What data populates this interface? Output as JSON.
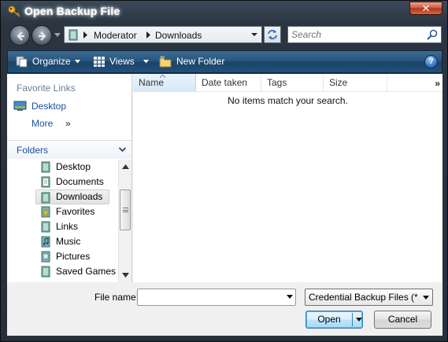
{
  "window": {
    "title": "Open Backup File",
    "title_icon": "key-icon",
    "close_glyph": "✕"
  },
  "address_bar": {
    "segments": [
      "Moderator",
      "Downloads"
    ],
    "folder_icon": "folder-icon"
  },
  "search": {
    "placeholder": "Search",
    "value": ""
  },
  "command_bar": {
    "organize_label": "Organize",
    "views_label": "Views",
    "new_folder_label": "New Folder",
    "help_glyph": "?"
  },
  "favorite_links": {
    "header": "Favorite Links",
    "items": [
      {
        "label": "Desktop",
        "icon": "desktop-icon"
      },
      {
        "label": "More",
        "icon": "chevron-right-icon",
        "suffix": "»"
      }
    ]
  },
  "folders": {
    "header": "Folders",
    "items": [
      {
        "label": "Desktop",
        "icon": "folder-icon",
        "selected": false
      },
      {
        "label": "Documents",
        "icon": "documents-icon",
        "selected": false
      },
      {
        "label": "Downloads",
        "icon": "folder-icon",
        "selected": true
      },
      {
        "label": "Favorites",
        "icon": "star-folder-icon",
        "selected": false
      },
      {
        "label": "Links",
        "icon": "folder-icon",
        "selected": false
      },
      {
        "label": "Music",
        "icon": "music-icon",
        "selected": false
      },
      {
        "label": "Pictures",
        "icon": "pictures-icon",
        "selected": false
      },
      {
        "label": "Saved Games",
        "icon": "folder-icon",
        "selected": false
      }
    ]
  },
  "file_list": {
    "columns": [
      "Name",
      "Date taken",
      "Tags",
      "Size"
    ],
    "more_columns_glyph": "»",
    "empty_message": "No items match your search."
  },
  "footer": {
    "file_name_label": "File name:",
    "file_name_value": "",
    "filter_value": "Credential Backup Files (*.crd",
    "open_label": "Open",
    "cancel_label": "Cancel"
  },
  "colors": {
    "frame_dark": "#26303b",
    "command_bar": "#25527a",
    "link_blue": "#1b4f9c",
    "selected_header": "#d6e9f8"
  }
}
